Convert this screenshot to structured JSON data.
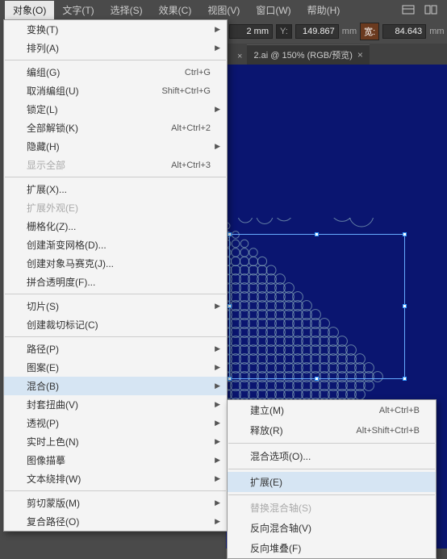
{
  "menubar": {
    "items": [
      {
        "label": "对象(O)",
        "active": true
      },
      {
        "label": "文字(T)"
      },
      {
        "label": "选择(S)"
      },
      {
        "label": "效果(C)"
      },
      {
        "label": "视图(V)"
      },
      {
        "label": "窗口(W)"
      },
      {
        "label": "帮助(H)"
      }
    ]
  },
  "toolbar": {
    "x_suffix": "2 mm",
    "y_label": "Y:",
    "y_value": "149.867",
    "w_label": "宽:",
    "w_value": "84.643",
    "unit": "mm"
  },
  "tab": {
    "prefix_x": "×",
    "label": "2.ai @ 150% (RGB/预览)",
    "close": "×"
  },
  "menu": [
    {
      "t": "sub",
      "label": "变换(T)"
    },
    {
      "t": "sub",
      "label": "排列(A)"
    },
    {
      "t": "sep"
    },
    {
      "t": "item",
      "label": "编组(G)",
      "sc": "Ctrl+G"
    },
    {
      "t": "item",
      "label": "取消编组(U)",
      "sc": "Shift+Ctrl+G"
    },
    {
      "t": "sub",
      "label": "锁定(L)"
    },
    {
      "t": "item",
      "label": "全部解锁(K)",
      "sc": "Alt+Ctrl+2"
    },
    {
      "t": "sub",
      "label": "隐藏(H)"
    },
    {
      "t": "item",
      "label": "显示全部",
      "sc": "Alt+Ctrl+3",
      "dis": true
    },
    {
      "t": "sep"
    },
    {
      "t": "item",
      "label": "扩展(X)..."
    },
    {
      "t": "item",
      "label": "扩展外观(E)",
      "dis": true
    },
    {
      "t": "item",
      "label": "栅格化(Z)..."
    },
    {
      "t": "item",
      "label": "创建渐变网格(D)..."
    },
    {
      "t": "item",
      "label": "创建对象马赛克(J)..."
    },
    {
      "t": "item",
      "label": "拼合透明度(F)..."
    },
    {
      "t": "sep"
    },
    {
      "t": "sub",
      "label": "切片(S)"
    },
    {
      "t": "item",
      "label": "创建裁切标记(C)"
    },
    {
      "t": "sep"
    },
    {
      "t": "sub",
      "label": "路径(P)"
    },
    {
      "t": "sub",
      "label": "图案(E)"
    },
    {
      "t": "sub",
      "label": "混合(B)",
      "hover": true
    },
    {
      "t": "sub",
      "label": "封套扭曲(V)"
    },
    {
      "t": "sub",
      "label": "透视(P)"
    },
    {
      "t": "sub",
      "label": "实时上色(N)"
    },
    {
      "t": "sub",
      "label": "图像描摹"
    },
    {
      "t": "sub",
      "label": "文本绕排(W)"
    },
    {
      "t": "sep"
    },
    {
      "t": "sub",
      "label": "剪切蒙版(M)"
    },
    {
      "t": "sub",
      "label": "复合路径(O)"
    }
  ],
  "submenu": [
    {
      "t": "item",
      "label": "建立(M)",
      "sc": "Alt+Ctrl+B"
    },
    {
      "t": "item",
      "label": "释放(R)",
      "sc": "Alt+Shift+Ctrl+B"
    },
    {
      "t": "sep"
    },
    {
      "t": "item",
      "label": "混合选项(O)..."
    },
    {
      "t": "sep"
    },
    {
      "t": "item",
      "label": "扩展(E)",
      "hover": true
    },
    {
      "t": "sep"
    },
    {
      "t": "item",
      "label": "替换混合轴(S)",
      "dis": true
    },
    {
      "t": "item",
      "label": "反向混合轴(V)"
    },
    {
      "t": "item",
      "label": "反向堆叠(F)"
    }
  ]
}
